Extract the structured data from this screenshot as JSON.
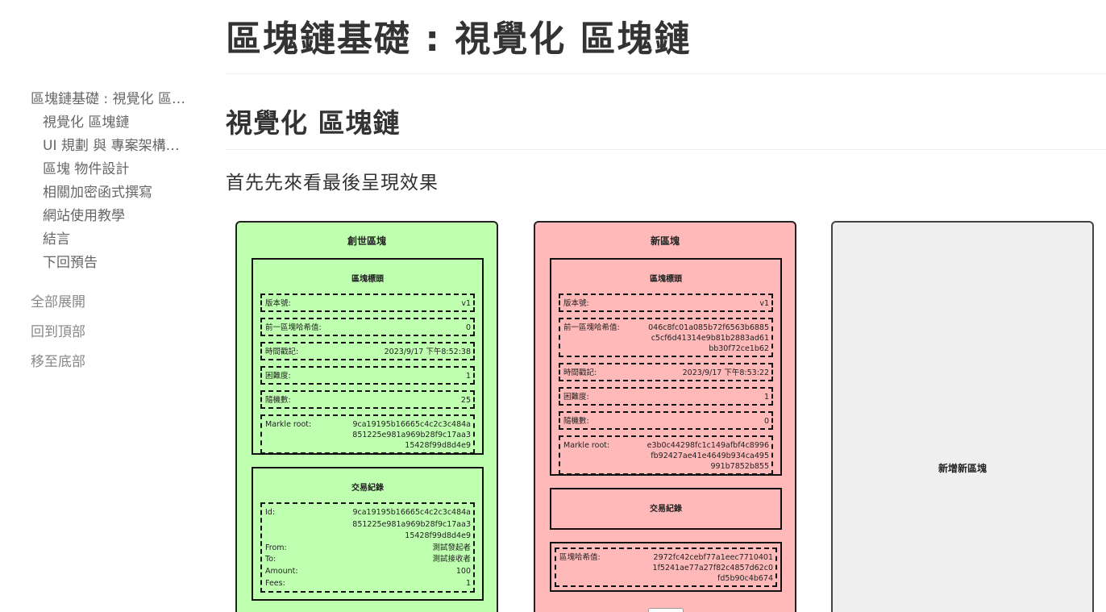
{
  "toc": {
    "items": [
      {
        "label": "區塊鏈基礎 : 視覺化 區塊鏈",
        "level": 1
      },
      {
        "label": "視覺化 區塊鏈",
        "level": 2
      },
      {
        "label": "UI 規劃 與 專案架構設計",
        "level": 2
      },
      {
        "label": "區塊 物件設計",
        "level": 2
      },
      {
        "label": "相關加密函式撰寫",
        "level": 2
      },
      {
        "label": "網站使用教學",
        "level": 2
      },
      {
        "label": "結言",
        "level": 2
      },
      {
        "label": "下回預告",
        "level": 2
      }
    ],
    "actions": {
      "expand_all": "全部展開",
      "back_to_top": "回到頂部",
      "go_to_bottom": "移至底部"
    }
  },
  "main": {
    "page_title": "區塊鏈基礎 : 視覺化 區塊鏈",
    "section_title": "視覺化 區塊鏈",
    "intro": "首先先來看最後呈現效果"
  },
  "chain": {
    "genesis": {
      "title": "創世區塊",
      "header": {
        "title": "區塊標頭",
        "fields": [
          {
            "key": "版本號:",
            "value": "v1"
          },
          {
            "key": "前一區塊哈希值:",
            "value": "0"
          },
          {
            "key": "時間戳記:",
            "value": "2023/9/17 下午8:52:38"
          },
          {
            "key": "困難度:",
            "value": "1"
          },
          {
            "key": "隨機數:",
            "value": "25"
          },
          {
            "key": "Markle root:",
            "value": "9ca19195b16665c4c2c3c484a851225e981a969b28f9c17aa315428f99d8d4e9"
          }
        ]
      },
      "transactions": {
        "title": "交易紀錄",
        "rows": [
          {
            "key": "Id:",
            "value": "9ca19195b16665c4c2c3c484a851225e981a969b28f9c17aa315428f99d8d4e9"
          },
          {
            "key": "From:",
            "value": "測試發起者"
          },
          {
            "key": "To:",
            "value": "測試接收者"
          },
          {
            "key": "Amount:",
            "value": "100"
          },
          {
            "key": "Fees:",
            "value": "1"
          }
        ]
      }
    },
    "new_block": {
      "title": "新區塊",
      "header": {
        "title": "區塊標頭",
        "fields": [
          {
            "key": "版本號:",
            "value": "v1"
          },
          {
            "key": "前一區塊哈希值:",
            "value": "046c8fc01a085b72f6563b6885c5cf6d41314e9b81b2883ad61bb30f72ce1b62"
          },
          {
            "key": "時間戳記:",
            "value": "2023/9/17 下午8:53:22"
          },
          {
            "key": "困難度:",
            "value": "1"
          },
          {
            "key": "隨機數:",
            "value": "0"
          },
          {
            "key": "Markle root:",
            "value": "e3b0c44298fc1c149afbf4c8996fb92427ae41e4649b934ca495991b7852b855"
          }
        ]
      },
      "transactions": {
        "title": "交易紀錄"
      },
      "hash": {
        "key": "區塊哈希值:",
        "value": "2972fc42cebf77a1eec77104011f5241ae77a27f82c4857d62c0fd5b90c4b674"
      }
    },
    "add_block": {
      "label": "新增新區塊"
    },
    "colors": {
      "genesis_bg": "#bfffb0",
      "new_block_bg": "#ffb9b9",
      "add_bg": "#efefef"
    }
  }
}
